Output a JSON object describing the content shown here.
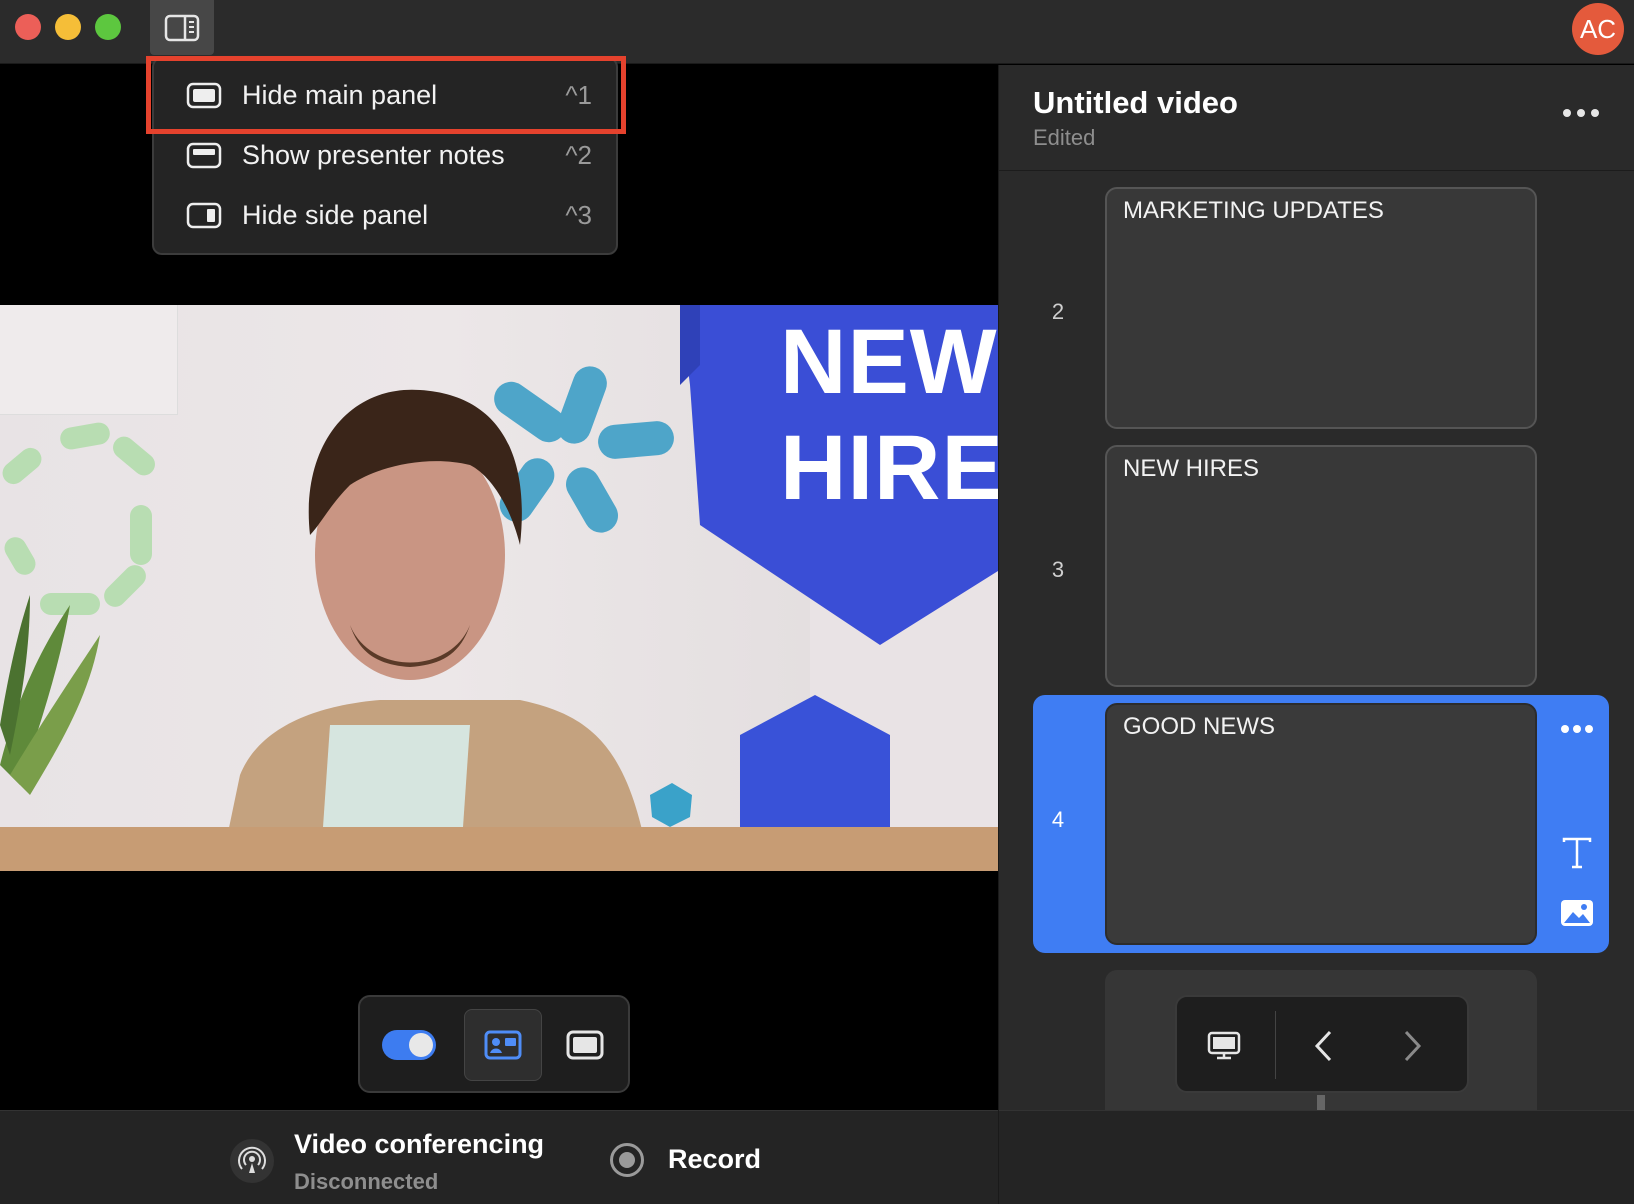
{
  "window": {
    "traffic_lights": [
      "close",
      "minimize",
      "zoom"
    ],
    "avatar_initials": "AC",
    "avatar_color": "#e45a3c"
  },
  "view_menu": {
    "items": [
      {
        "label": "Hide main panel",
        "shortcut": "^1",
        "icon": "main-panel-icon"
      },
      {
        "label": "Show presenter notes",
        "shortcut": "^2",
        "icon": "presenter-notes-icon"
      },
      {
        "label": "Hide side panel",
        "shortcut": "^3",
        "icon": "side-panel-icon"
      }
    ],
    "highlighted_index": 0,
    "highlight_color": "#e5422d"
  },
  "stage": {
    "slide_banner_text": "NEW\nHIRES",
    "accent_color": "#3a4ed6"
  },
  "layout_toolbar": {
    "toggle_on": true,
    "buttons": [
      "presenter-layout-icon",
      "slide-only-icon"
    ]
  },
  "bottom_bar": {
    "video_conferencing_title": "Video conferencing",
    "video_conferencing_status": "Disconnected",
    "record_label": "Record"
  },
  "side_panel": {
    "title": "Untitled video",
    "status": "Edited",
    "slides": [
      {
        "number": "2",
        "title": "MARKETING UPDATES",
        "selected": false
      },
      {
        "number": "3",
        "title": "NEW HIRES",
        "selected": false
      },
      {
        "number": "4",
        "title": "GOOD NEWS",
        "selected": true
      }
    ],
    "selected_color": "#3f7df3"
  }
}
